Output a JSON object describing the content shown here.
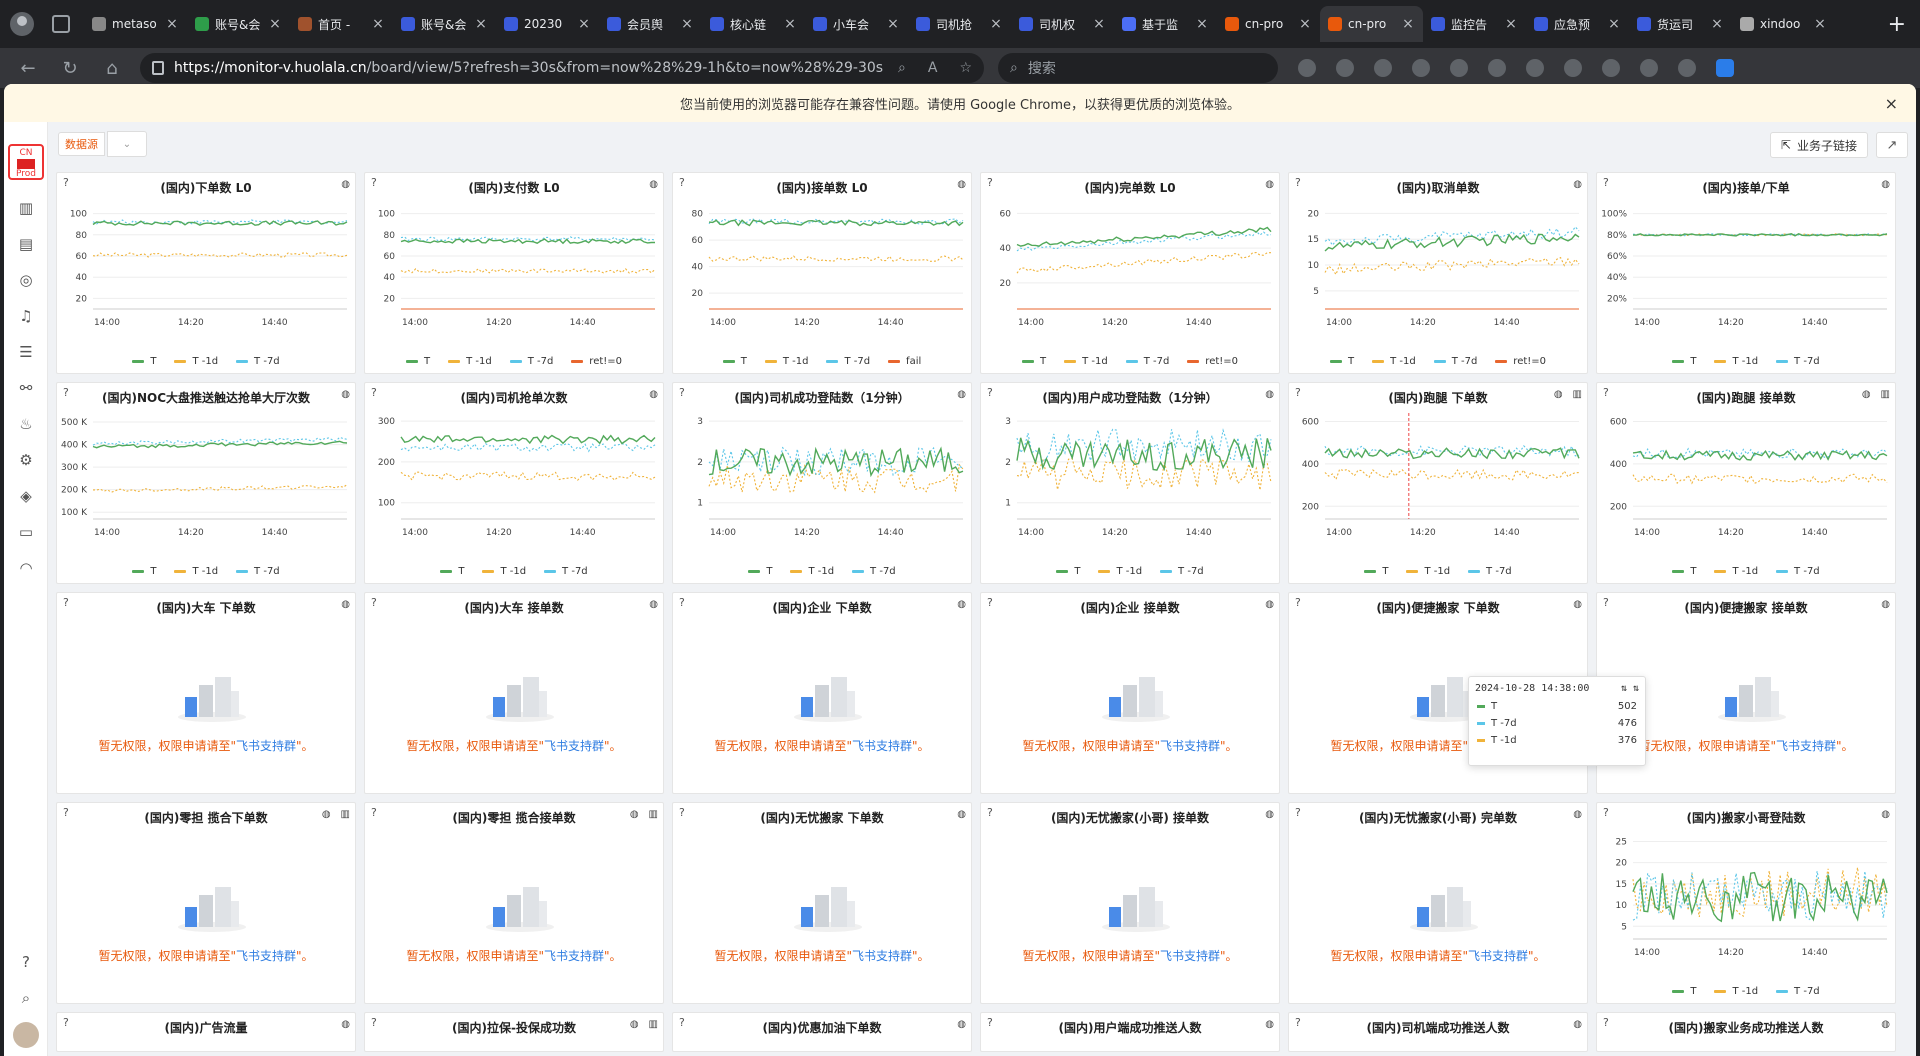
{
  "browser": {
    "tabs": [
      {
        "label": "metaso",
        "color": "#888"
      },
      {
        "label": "账号&会",
        "color": "#2e9d4a"
      },
      {
        "label": "首页 - ",
        "color": "#a0522d"
      },
      {
        "label": "账号&会",
        "color": "#3b5bdb"
      },
      {
        "label": "20230",
        "color": "#3b5bdb"
      },
      {
        "label": "会员舆",
        "color": "#3b5bdb"
      },
      {
        "label": "核心链",
        "color": "#3b5bdb"
      },
      {
        "label": "小车会",
        "color": "#3b5bdb"
      },
      {
        "label": "司机抢",
        "color": "#3b5bdb"
      },
      {
        "label": "司机权",
        "color": "#3b5bdb"
      },
      {
        "label": "基于监",
        "color": "#4c6ef5"
      },
      {
        "label": "cn-pro",
        "color": "#e8590c"
      },
      {
        "label": "cn-pro",
        "color": "#e8590c",
        "active": true
      },
      {
        "label": "监控告",
        "color": "#3b5bdb"
      },
      {
        "label": "应急预",
        "color": "#3b5bdb"
      },
      {
        "label": "货运司",
        "color": "#3b5bdb"
      },
      {
        "label": "xindoo",
        "color": "#aaa"
      }
    ],
    "url_host": "https://monitor-v.huolala.cn",
    "url_path": "/board/view/5?refresh=30s&from=now%28%29-1h&to=now%28%29-30s",
    "search_placeholder": "搜索"
  },
  "warning": {
    "text": "您当前使用的浏览器可能存在兼容性问题。请使用 Google Chrome，以获得更优质的浏览体验。",
    "close": "×"
  },
  "env": {
    "line1": "CN",
    "line2": "Prod"
  },
  "toolbar": {
    "datasource_label": "数据源",
    "datasource_arrow": "⌄",
    "biz_link_label": "业务子链接",
    "biz_link_icon": "⇱",
    "external_icon": "↗"
  },
  "colors": {
    "T": "#52a95a",
    "T1d": "#f0b33a",
    "T7d": "#5bc6e8",
    "err": "#e8662e"
  },
  "no_permission": {
    "prefix": "暂无权限，权限申请请至\"",
    "group": "飞书支持群",
    "suffix": "\"。"
  },
  "tooltip": {
    "time": "2024-10-28 14:38:00",
    "rows": [
      {
        "name": "T",
        "value": "502",
        "color": "#52a95a"
      },
      {
        "name": "T -7d",
        "value": "476",
        "color": "#5bc6e8"
      },
      {
        "name": "T -1d",
        "value": "376",
        "color": "#f0b33a"
      }
    ]
  },
  "panels": [
    {
      "title": "(国内)下单数 L0",
      "type": "line",
      "yticks": [
        "100",
        "80",
        "60",
        "40",
        "20"
      ],
      "ymax": 110,
      "ymin": 10,
      "xticks": [
        "14:00",
        "14:20",
        "14:40"
      ],
      "legend": [
        "T",
        "T -1d",
        "T -7d"
      ],
      "series": {
        "T": 91,
        "T1d": 61,
        "T7d": 92
      },
      "noise": 2
    },
    {
      "title": "(国内)支付数 L0",
      "type": "line",
      "yticks": [
        "100",
        "80",
        "60",
        "40",
        "20"
      ],
      "ymax": 110,
      "ymin": 10,
      "xticks": [
        "14:00",
        "14:20",
        "14:40"
      ],
      "legend": [
        "T",
        "T -1d",
        "T -7d",
        "ret!=0"
      ],
      "series": {
        "T": 74,
        "T1d": 46,
        "T7d": 76,
        "err": 10
      },
      "noise": 2
    },
    {
      "title": "(国内)接单数 L0",
      "type": "line",
      "yticks": [
        "80",
        "60",
        "40",
        "20"
      ],
      "ymax": 88,
      "ymin": 8,
      "xticks": [
        "14:00",
        "14:20",
        "14:40"
      ],
      "legend": [
        "T",
        "T -1d",
        "T -7d",
        "fail"
      ],
      "series": {
        "T": 73,
        "T1d": 46,
        "T7d": 74,
        "err": 8
      },
      "noise": 2
    },
    {
      "title": "(国内)完单数 L0",
      "type": "line",
      "yticks": [
        "60",
        "40",
        "20"
      ],
      "ymax": 66,
      "ymin": 5,
      "xticks": [
        "14:00",
        "14:20",
        "14:40"
      ],
      "legend": [
        "T",
        "T -1d",
        "T -7d",
        "ret!=0"
      ],
      "series": {
        "T": 46,
        "T1d": 32,
        "T7d": 44,
        "err": 5
      },
      "noise": 1.5,
      "trend": 10
    },
    {
      "title": "(国内)取消单数",
      "type": "line",
      "yticks": [
        "20",
        "15",
        "10",
        "5"
      ],
      "ymax": 22,
      "ymin": 1.5,
      "xticks": [
        "14:00",
        "14:20",
        "14:40"
      ],
      "legend": [
        "T",
        "T -1d",
        "T -7d",
        "ret!=0"
      ],
      "series": {
        "T": 14.5,
        "T1d": 10,
        "T7d": 15.5,
        "err": 1.5
      },
      "noise": 1,
      "trend": 2
    },
    {
      "title": "(国内)接单/下单",
      "type": "line",
      "yticks": [
        "100%",
        "80%",
        "60%",
        "40%",
        "20%"
      ],
      "ymax": 110,
      "ymin": 10,
      "xticks": [
        "14:00",
        "14:20",
        "14:40"
      ],
      "legend": [
        "T",
        "T -1d",
        "T -7d"
      ],
      "series": {
        "T": 80,
        "T1d": 80,
        "T7d": 80
      },
      "noise": 1
    },
    {
      "title": "(国内)NOC大盘推送触达抢单大厅次数",
      "type": "line",
      "yticks": [
        "500 K",
        "400 K",
        "300 K",
        "200 K",
        "100 K"
      ],
      "ymax": 540,
      "ymin": 70,
      "xticks": [
        "14:00",
        "14:20",
        "14:40"
      ],
      "legend": [
        "T",
        "T -1d",
        "T -7d"
      ],
      "series": {
        "T": 400,
        "T1d": 205,
        "T7d": 415
      },
      "noise": 8,
      "trend": 20
    },
    {
      "title": "(国内)司机抢单次数",
      "type": "line",
      "yticks": [
        "300",
        "200",
        "100"
      ],
      "ymax": 320,
      "ymin": 60,
      "xticks": [
        "14:00",
        "14:20",
        "14:40"
      ],
      "legend": [
        "T",
        "T -1d",
        "T -7d"
      ],
      "series": {
        "T": 255,
        "T1d": 165,
        "T7d": 235
      },
      "noise": 10
    },
    {
      "title": "(国内)司机成功登陆数（1分钟）",
      "type": "line",
      "yticks": [
        "3",
        "2",
        "1"
      ],
      "ymax": 3.2,
      "ymin": 0.6,
      "xticks": [
        "14:00",
        "14:20",
        "14:40"
      ],
      "legend": [
        "T",
        "T -1d",
        "T -7d"
      ],
      "series": {
        "T": 2.0,
        "T1d": 1.6,
        "T7d": 2.0
      },
      "noise": 0.35
    },
    {
      "title": "(国内)用户成功登陆数（1分钟）",
      "type": "line",
      "yticks": [
        "3",
        "2",
        "1"
      ],
      "ymax": 3.2,
      "ymin": 0.6,
      "xticks": [
        "14:00",
        "14:20",
        "14:40"
      ],
      "legend": [
        "T",
        "T -1d",
        "T -7d"
      ],
      "series": {
        "T": 2.2,
        "T1d": 1.7,
        "T7d": 2.4
      },
      "noise": 0.4
    },
    {
      "title": "(国内)跑腿 下单数",
      "type": "line",
      "yticks": [
        "600",
        "400",
        "200"
      ],
      "ymax": 640,
      "ymin": 140,
      "xticks": [
        "14:00",
        "14:20",
        "14:40"
      ],
      "legend": [
        "T",
        "T -1d",
        "T -7d"
      ],
      "series": {
        "T": 450,
        "T1d": 350,
        "T7d": 460
      },
      "noise": 25,
      "extra_btn": true,
      "marker": 0.33
    },
    {
      "title": "(国内)跑腿 接单数",
      "type": "line",
      "yticks": [
        "600",
        "400",
        "200"
      ],
      "ymax": 640,
      "ymin": 140,
      "xticks": [
        "14:00",
        "14:20",
        "14:40"
      ],
      "legend": [
        "T",
        "T -1d",
        "T -7d"
      ],
      "series": {
        "T": 440,
        "T1d": 330,
        "T7d": 450
      },
      "noise": 22,
      "extra_btn": true
    },
    {
      "title": "(国内)大车 下单数",
      "type": "noperm"
    },
    {
      "title": "(国内)大车 接单数",
      "type": "noperm"
    },
    {
      "title": "(国内)企业 下单数",
      "type": "noperm"
    },
    {
      "title": "(国内)企业 接单数",
      "type": "noperm"
    },
    {
      "title": "(国内)便捷搬家 下单数",
      "type": "noperm"
    },
    {
      "title": "(国内)便捷搬家 接单数",
      "type": "noperm"
    },
    {
      "title": "(国内)零担 揽合下单数",
      "type": "noperm",
      "extra_btn": true
    },
    {
      "title": "(国内)零担 揽合接单数",
      "type": "noperm",
      "extra_btn": true
    },
    {
      "title": "(国内)无忧搬家 下单数",
      "type": "noperm"
    },
    {
      "title": "(国内)无忧搬家(小哥) 接单数",
      "type": "noperm"
    },
    {
      "title": "(国内)无忧搬家(小哥) 完单数",
      "type": "noperm"
    },
    {
      "title": "(国内)搬家小哥登陆数",
      "type": "line",
      "yticks": [
        "25",
        "20",
        "15",
        "10",
        "5"
      ],
      "ymax": 27,
      "ymin": 2,
      "xticks": [
        "14:00",
        "14:20",
        "14:40"
      ],
      "legend": [
        "T",
        "T -1d",
        "T -7d"
      ],
      "series": {
        "T": 12,
        "T1d": 13,
        "T7d": 12
      },
      "noise": 6
    },
    {
      "title": "(国内)广告流量",
      "type": "stub"
    },
    {
      "title": "(国内)拉保-投保成功数",
      "type": "stub",
      "extra_btn": true
    },
    {
      "title": "(国内)优惠加油下单数",
      "type": "stub"
    },
    {
      "title": "(国内)用户端成功推送人数",
      "type": "stub"
    },
    {
      "title": "(国内)司机端成功推送人数",
      "type": "stub"
    },
    {
      "title": "(国内)搬家业务成功推送人数",
      "type": "stub"
    }
  ]
}
